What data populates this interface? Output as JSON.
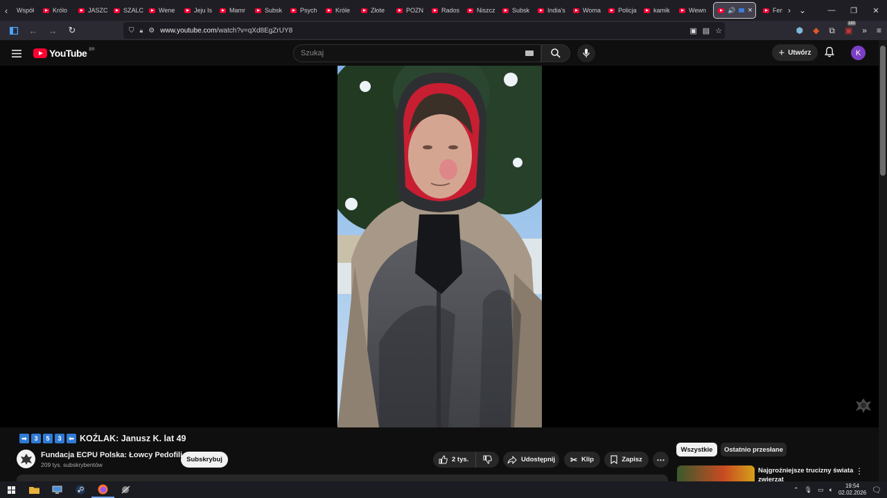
{
  "browser": {
    "tabs": [
      {
        "label": "Współ"
      },
      {
        "label": "Królo"
      },
      {
        "label": "JASZC"
      },
      {
        "label": "SZALC"
      },
      {
        "label": "Wene"
      },
      {
        "label": "Jeju Is"
      },
      {
        "label": "Mamr"
      },
      {
        "label": "Subsk"
      },
      {
        "label": "Psych"
      },
      {
        "label": "Króle"
      },
      {
        "label": "Złote"
      },
      {
        "label": "POZN"
      },
      {
        "label": "Rados"
      },
      {
        "label": "Niszcz"
      },
      {
        "label": "Subsk"
      },
      {
        "label": "India's"
      },
      {
        "label": "Woma"
      },
      {
        "label": "Policja"
      },
      {
        "label": "kamik"
      },
      {
        "label": "Wewn"
      }
    ],
    "active_tab_close": "×",
    "last_tab": {
      "label": "Fem"
    },
    "url_host": "www.youtube.com",
    "url_path": "/watch?v=qXd8EgZrUY8",
    "extension_badge": "180"
  },
  "youtube": {
    "logo_text": "YouTube",
    "country_code": "BR",
    "search_placeholder": "Szukaj",
    "create_label": "Utwórz",
    "avatar_letter": "K"
  },
  "video": {
    "title_numbers": [
      "3",
      "5",
      "3"
    ],
    "title_arrow_left": "➡",
    "title_arrow_right": "⬅",
    "title": "KOŹLAK: Janusz K. lat 49",
    "channel_name": "Fundacja ECPU Polska: Łowcy Pedofili",
    "subscribers": "209 tys. subskrybentów",
    "subscribe_label": "Subskrybuj",
    "likes": "2 tys.",
    "share_label": "Udostępnij",
    "clip_label": "Klip",
    "save_label": "Zapisz",
    "more_label": "⋯"
  },
  "sidebar": {
    "chips": [
      "Wszystkie",
      "Ostatnio przesłane"
    ],
    "recommendation_title": "Najgroźniejsze trucizny świata zwierząt"
  },
  "taskbar": {
    "time": "19:54",
    "date": "02.02.2026"
  },
  "colors": {
    "youtube_red": "#ff0033",
    "avatar_purple": "#7b3fc4",
    "number_box_blue": "#2f7bd6"
  }
}
